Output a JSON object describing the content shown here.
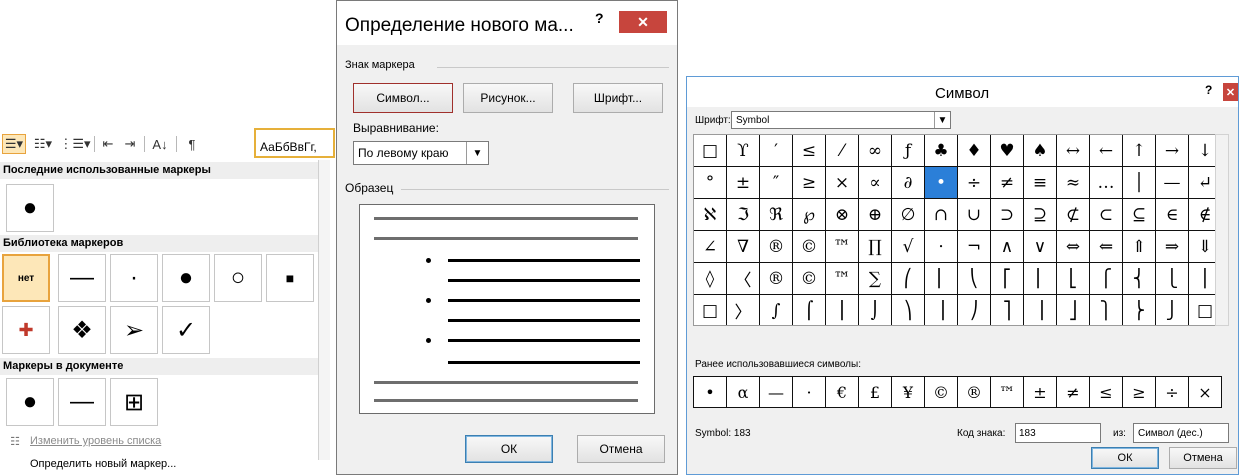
{
  "left_panel": {
    "toolbar_icons": [
      "bullets-icon",
      "numbering-icon",
      "multilevel-list-icon",
      "decrease-indent-icon",
      "increase-indent-icon",
      "sort-icon",
      "pilcrow-icon"
    ],
    "styles_preview": "АаБбВвГг,",
    "recent_header": "Последние использованные маркеры",
    "recent_items": [
      "●"
    ],
    "library_header": "Библиотека маркеров",
    "library_row1": [
      "нет",
      "—",
      "·",
      "●",
      "○",
      "■"
    ],
    "library_row2": [
      "✚",
      "❖",
      "➢",
      "✓"
    ],
    "document_header": "Маркеры в документе",
    "document_items": [
      "●",
      "—",
      "⊞"
    ],
    "menu_change_level": "Изменить уровень списка",
    "menu_define_new": "Определить новый маркер..."
  },
  "dialog_define": {
    "title": "Определение нового ма...",
    "help": "?",
    "close": "✕",
    "group_marker": "Знак маркера",
    "btn_symbol": "Символ...",
    "btn_picture": "Рисунок...",
    "btn_font": "Шрифт...",
    "alignment_label": "Выравнивание:",
    "alignment_value": "По левому краю",
    "group_preview": "Образец",
    "btn_ok": "ОК",
    "btn_cancel": "Отмена"
  },
  "dialog_symbol": {
    "title": "Символ",
    "help": "?",
    "close": "✕",
    "font_label": "Шрифт:",
    "font_value": "Symbol",
    "grid": [
      [
        "□",
        "ϒ",
        "′",
        "≤",
        "⁄",
        "∞",
        "ƒ",
        "♣",
        "♦",
        "♥",
        "♠",
        "↔",
        "←",
        "↑",
        "→",
        "↓"
      ],
      [
        "°",
        "±",
        "″",
        "≥",
        "×",
        "∝",
        "∂",
        "•",
        "÷",
        "≠",
        "≡",
        "≈",
        "…",
        "│",
        "—",
        "↵"
      ],
      [
        "ℵ",
        "ℑ",
        "ℜ",
        "℘",
        "⊗",
        "⊕",
        "∅",
        "∩",
        "∪",
        "⊃",
        "⊇",
        "⊄",
        "⊂",
        "⊆",
        "∈",
        "∉"
      ],
      [
        "∠",
        "∇",
        "®",
        "©",
        "™",
        "∏",
        "√",
        "⋅",
        "¬",
        "∧",
        "∨",
        "⇔",
        "⇐",
        "⇑",
        "⇒",
        "⇓"
      ],
      [
        "◊",
        "〈",
        "®",
        "©",
        "™",
        "∑",
        "⎛",
        "⎜",
        "⎝",
        "⎡",
        "⎢",
        "⎣",
        "⎧",
        "⎨",
        "⎩",
        "⎪"
      ],
      [
        "□",
        "〉",
        "∫",
        "⌠",
        "⎮",
        "⌡",
        "⎞",
        "⎟",
        "⎠",
        "⎤",
        "⎥",
        "⎦",
        "⎫",
        "⎬",
        "⎭",
        "□"
      ]
    ],
    "selected_symbol": "•",
    "recent_label": "Ранее использовавшиеся символы:",
    "recent": [
      "•",
      "α",
      "—",
      "·",
      "€",
      "£",
      "¥",
      "©",
      "®",
      "™",
      "±",
      "≠",
      "≤",
      "≥",
      "÷",
      "×"
    ],
    "status_name": "Symbol: 183",
    "code_label": "Код знака:",
    "code_value": "183",
    "from_label": "из:",
    "from_value": "Символ (дес.)",
    "btn_ok": "ОК",
    "btn_cancel": "Отмена"
  },
  "colors": {
    "accent_orange": "#e8a33d",
    "close_red": "#c7453d",
    "selection_blue": "#2b7fd8"
  }
}
